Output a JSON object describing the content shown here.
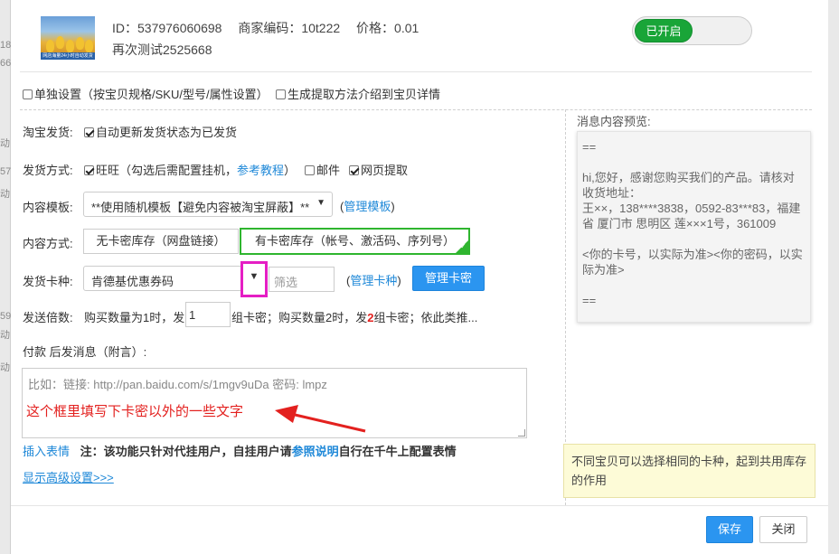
{
  "header": {
    "id_text": "ID：537976060698",
    "merchant_code": "商家编码：10t222",
    "price": "价格：0.01",
    "product_name": "再次测试2525668",
    "thumb_caption": "网店海量24小时自动发货",
    "toggle_label": "已开启"
  },
  "options": {
    "separate_setting": "单独设置（按宝贝规格/SKU/型号/属性设置）",
    "gen_intro": "生成提取方法介绍到宝贝详情"
  },
  "taobao_ship": {
    "label": "淘宝发货:",
    "checkbox_text": "自动更新发货状态为已发货"
  },
  "ship_method": {
    "label": "发货方式:",
    "wangwang": "旺旺（勾选后需配置挂机，",
    "tutorial_link": "参考教程",
    "close_paren": "）",
    "email": "邮件",
    "web": "网页提取"
  },
  "template": {
    "label": "内容模板:",
    "selected": "**使用随机模板【避免内容被淘宝屏蔽】**",
    "open_paren": "(",
    "manage_link": "管理模板",
    "close_paren": ")"
  },
  "content_mode": {
    "label": "内容方式:",
    "option1": "无卡密库存（网盘链接）",
    "option2": "有卡密库存（帐号、激活码、序列号）"
  },
  "card_type": {
    "label": "发货卡种:",
    "selected": "肯德基优惠券码",
    "filter_placeholder": "筛选",
    "open_paren": "(",
    "manage_link": "管理卡种",
    "close_paren": ")",
    "manage_button": "管理卡密"
  },
  "multiplier": {
    "label": "发送倍数:",
    "text1": "购买数量为1时，发",
    "value": "1",
    "text2": "组卡密；购买数量2时，发",
    "red_num": "2",
    "text3": "组卡密；依此类推..."
  },
  "after_pay": {
    "label": "付款 后发消息（附言）:",
    "placeholder": "比如：链接: http://pan.baidu.com/s/1mgv9uDa 密码: lmpz",
    "red_annotation": "这个框里填写下卡密以外的一些文字"
  },
  "emoji": {
    "insert_link": "插入表情",
    "note_pre": "注：该功能只针对代挂用户，自挂用户请",
    "ref_link": "参照说明",
    "note_post": "自行在千牛上配置表情"
  },
  "advanced_link": "显示高级设置>>>",
  "preview": {
    "label": "消息内容预览:",
    "line1": "==",
    "line2": "hi,您好，感谢您购买我们的产品。请核对收货地址：",
    "line3": "王××，138****3838，0592-83***83，福建省 厦门市 思明区 莲×××1号，361009",
    "line4": "<你的卡号，以实际为准><你的密码，以实际为准>",
    "line5": "=="
  },
  "tip": "不同宝贝可以选择相同的卡种，起到共用库存的作用",
  "footer": {
    "save": "保存",
    "close": "关闭"
  },
  "background_edge": [
    "18",
    "66",
    "动",
    "57",
    "动",
    "59",
    "动",
    "动"
  ],
  "colors": {
    "toggle_on": "#19a538",
    "link": "#1e88d8",
    "primary_button": "#2b95f0",
    "selected_border": "#2fb52f",
    "highlight_box": "#e51ec4",
    "annotation_red": "#e3211f",
    "tip_bg": "#fdfbd7"
  }
}
